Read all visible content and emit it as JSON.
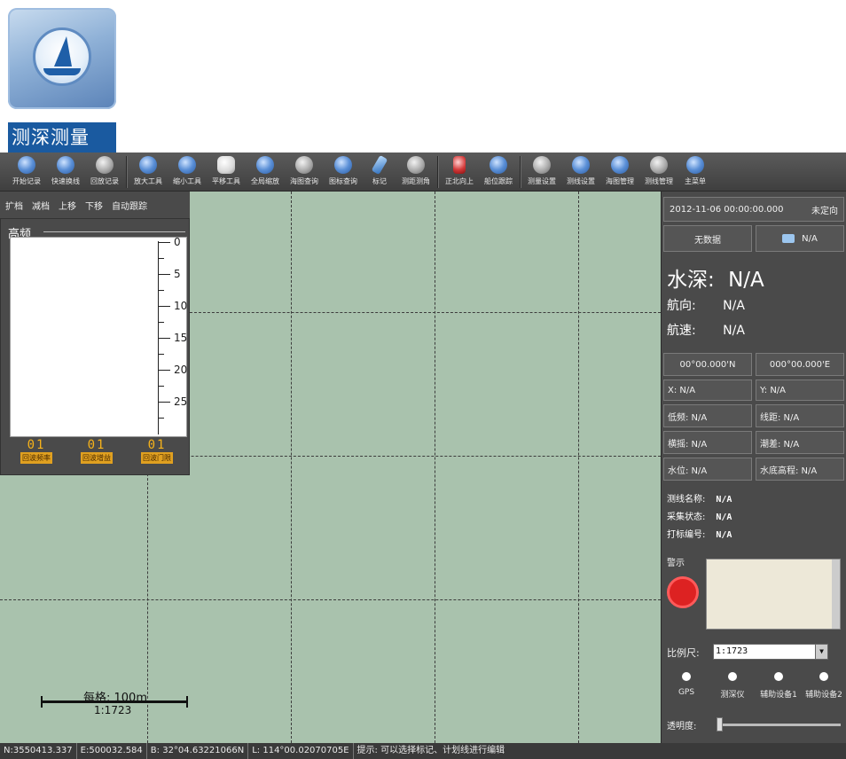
{
  "app_icon": {
    "label": "测深测量"
  },
  "toolbar": {
    "items": [
      "开始记录",
      "快速换线",
      "回放记录",
      "放大工具",
      "缩小工具",
      "平移工具",
      "全局缩放",
      "海图查询",
      "图标查询",
      "标记",
      "测距测角",
      "正北向上",
      "船位跟踪",
      "测量设置",
      "测线设置",
      "海图管理",
      "测线管理",
      "主菜单"
    ]
  },
  "left_controls": {
    "items": [
      "扩档",
      "减档",
      "上移",
      "下移",
      "自动跟踪"
    ]
  },
  "echo": {
    "title": "高频",
    "ticks": [
      "0",
      "5",
      "10",
      "15",
      "20",
      "25"
    ],
    "counters": [
      {
        "value": "01",
        "label": "回波频率"
      },
      {
        "value": "01",
        "label": "回波增益"
      },
      {
        "value": "01",
        "label": "回波门限"
      }
    ]
  },
  "map": {
    "scale_text": "每格: 100m",
    "ratio_text": "1:1723"
  },
  "right": {
    "datetime": "2012-11-06 00:00:00.000",
    "fix_status": "未定向",
    "data_status": "无数据",
    "sat_value": "N/A",
    "depth_label": "水深:",
    "depth_value": "N/A",
    "heading_label": "航向:",
    "heading_value": "N/A",
    "speed_label": "航速:",
    "speed_value": "N/A",
    "lat": "00°00.000'N",
    "lon": "000°00.000'E",
    "x": "X:  N/A",
    "y": "Y:  N/A",
    "low_freq": "低频:  N/A",
    "line_len": "线距:  N/A",
    "high_freq": "横摇:  N/A",
    "tide": "潮差:  N/A",
    "water_level": "水位:  N/A",
    "water_elev": "水底高程:  N/A",
    "line_name_label": "测线名称:",
    "line_name_value": "N/A",
    "collect_label": "采集状态:",
    "collect_value": "N/A",
    "mark_label": "打标编号:",
    "mark_value": "N/A",
    "warn_label": "警示",
    "scale_label": "比例尺:",
    "scale_value": "1:1723",
    "devices": [
      "GPS",
      "测深仪",
      "辅助设备1",
      "辅助设备2"
    ],
    "transparency_label": "透明度:"
  },
  "status": {
    "n": "N:3550413.337",
    "e": "E:500032.584",
    "b": "B: 32°04.63221066N",
    "l": "L: 114°00.02070705E",
    "hint": "提示: 可以选择标记、计划线进行编辑"
  }
}
